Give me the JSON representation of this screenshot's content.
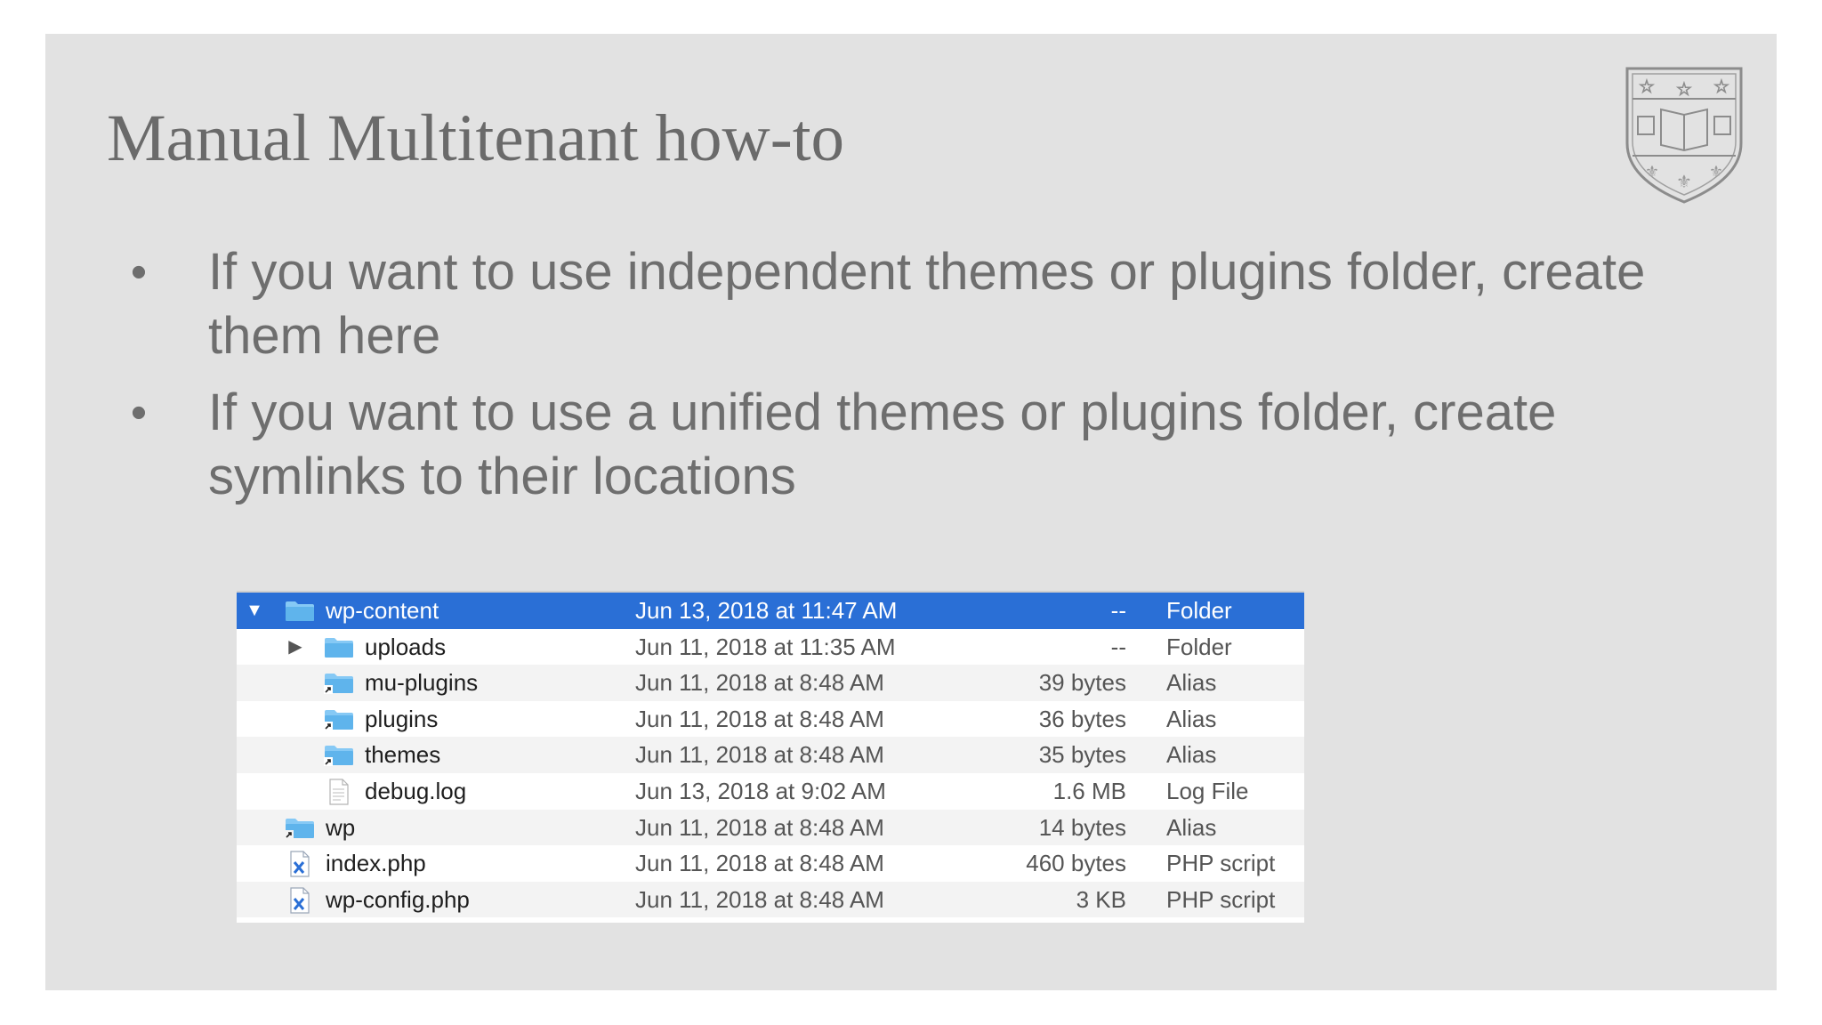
{
  "slide": {
    "title": "Manual Multitenant how-to",
    "bullets": [
      "If you want to use independent themes or plugins folder, create them here",
      "If you want to use a unified themes or plugins folder, create symlinks to their locations"
    ],
    "bullet_marker": "•"
  },
  "finder": {
    "rows": [
      {
        "name": "wp-content",
        "date": "Jun 13, 2018 at 11:47 AM",
        "size": "--",
        "kind": "Folder",
        "disclosure": "▼",
        "icon": "folder-icon"
      },
      {
        "name": "uploads",
        "date": "Jun 11, 2018 at 11:35 AM",
        "size": "--",
        "kind": "Folder",
        "disclosure": "▶",
        "icon": "folder-icon"
      },
      {
        "name": "mu-plugins",
        "date": "Jun 11, 2018 at 8:48 AM",
        "size": "39 bytes",
        "kind": "Alias",
        "disclosure": "",
        "icon": "folder-alias-icon"
      },
      {
        "name": "plugins",
        "date": "Jun 11, 2018 at 8:48 AM",
        "size": "36 bytes",
        "kind": "Alias",
        "disclosure": "",
        "icon": "folder-alias-icon"
      },
      {
        "name": "themes",
        "date": "Jun 11, 2018 at 8:48 AM",
        "size": "35 bytes",
        "kind": "Alias",
        "disclosure": "",
        "icon": "folder-alias-icon"
      },
      {
        "name": "debug.log",
        "date": "Jun 13, 2018 at 9:02 AM",
        "size": "1.6 MB",
        "kind": "Log File",
        "disclosure": "",
        "icon": "document-icon"
      },
      {
        "name": "wp",
        "date": "Jun 11, 2018 at 8:48 AM",
        "size": "14 bytes",
        "kind": "Alias",
        "disclosure": "",
        "icon": "folder-alias-icon"
      },
      {
        "name": "index.php",
        "date": "Jun 11, 2018 at 8:48 AM",
        "size": "460 bytes",
        "kind": "PHP script",
        "disclosure": "",
        "icon": "php-file-icon"
      },
      {
        "name": "wp-config.php",
        "date": "Jun 11, 2018 at 8:48 AM",
        "size": "3 KB",
        "kind": "PHP script",
        "disclosure": "",
        "icon": "php-file-icon"
      }
    ]
  },
  "colors": {
    "slide_background": "#e2e2e2",
    "text_gray": "#6e6e6e",
    "selection_blue": "#2a6fd6",
    "folder_blue": "#5fb4ec"
  }
}
